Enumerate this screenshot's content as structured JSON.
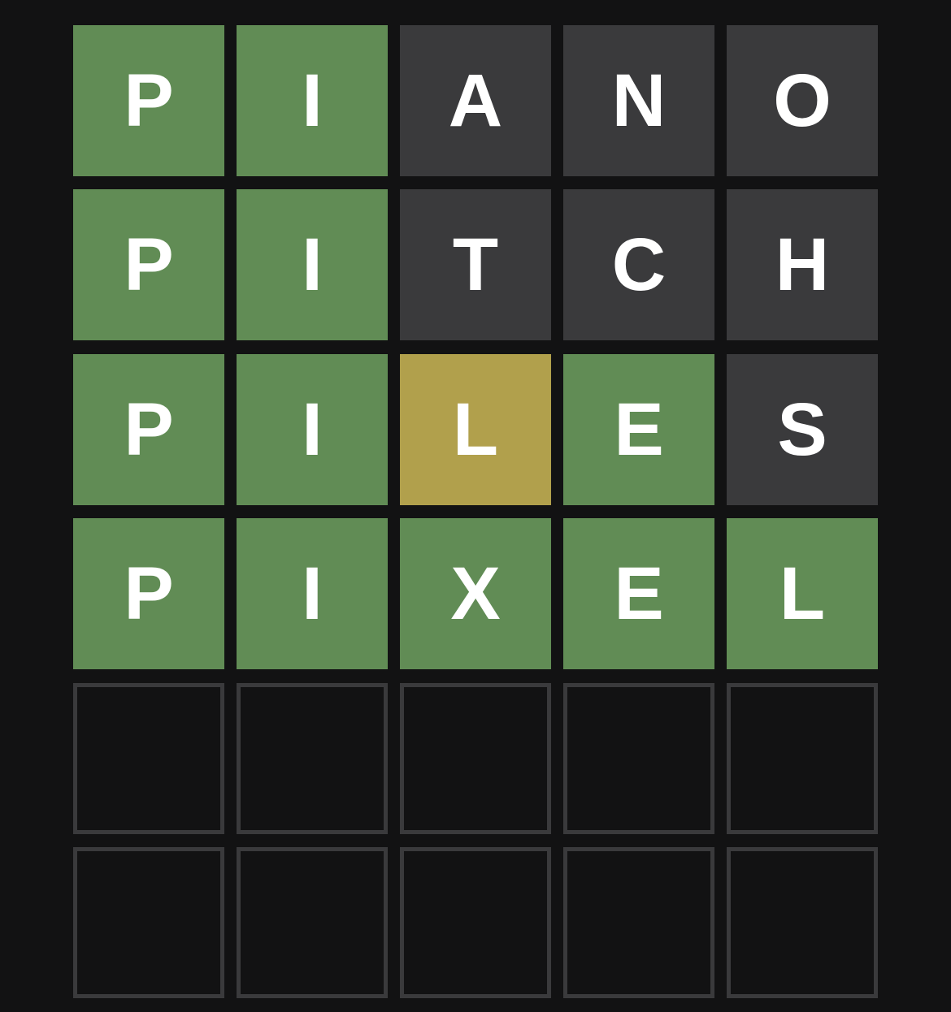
{
  "colors": {
    "background": "#121213",
    "correct": "#618c55",
    "present": "#b1a04c",
    "absent": "#3a3a3c",
    "empty_border": "#3a3a3c",
    "letter": "#ffffff"
  },
  "board": {
    "rows": [
      {
        "tiles": [
          {
            "letter": "P",
            "state": "correct"
          },
          {
            "letter": "I",
            "state": "correct"
          },
          {
            "letter": "A",
            "state": "absent"
          },
          {
            "letter": "N",
            "state": "absent"
          },
          {
            "letter": "O",
            "state": "absent"
          }
        ]
      },
      {
        "tiles": [
          {
            "letter": "P",
            "state": "correct"
          },
          {
            "letter": "I",
            "state": "correct"
          },
          {
            "letter": "T",
            "state": "absent"
          },
          {
            "letter": "C",
            "state": "absent"
          },
          {
            "letter": "H",
            "state": "absent"
          }
        ]
      },
      {
        "tiles": [
          {
            "letter": "P",
            "state": "correct"
          },
          {
            "letter": "I",
            "state": "correct"
          },
          {
            "letter": "L",
            "state": "present"
          },
          {
            "letter": "E",
            "state": "correct"
          },
          {
            "letter": "S",
            "state": "absent"
          }
        ]
      },
      {
        "tiles": [
          {
            "letter": "P",
            "state": "correct"
          },
          {
            "letter": "I",
            "state": "correct"
          },
          {
            "letter": "X",
            "state": "correct"
          },
          {
            "letter": "E",
            "state": "correct"
          },
          {
            "letter": "L",
            "state": "correct"
          }
        ]
      },
      {
        "tiles": [
          {
            "letter": "",
            "state": "empty"
          },
          {
            "letter": "",
            "state": "empty"
          },
          {
            "letter": "",
            "state": "empty"
          },
          {
            "letter": "",
            "state": "empty"
          },
          {
            "letter": "",
            "state": "empty"
          }
        ]
      },
      {
        "tiles": [
          {
            "letter": "",
            "state": "empty"
          },
          {
            "letter": "",
            "state": "empty"
          },
          {
            "letter": "",
            "state": "empty"
          },
          {
            "letter": "",
            "state": "empty"
          },
          {
            "letter": "",
            "state": "empty"
          }
        ]
      }
    ]
  }
}
